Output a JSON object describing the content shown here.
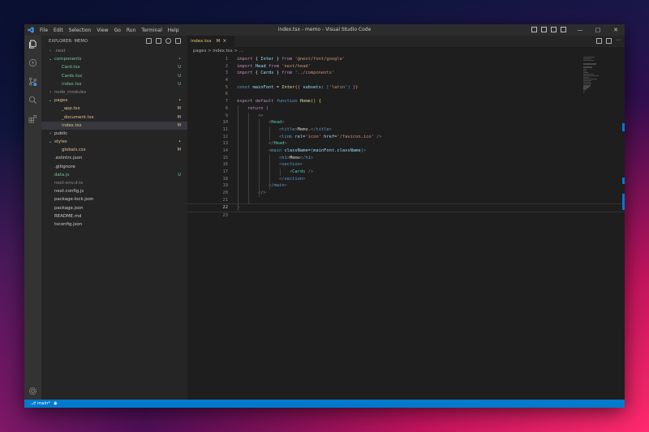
{
  "titlebar": {
    "title": "index.tsx - memo - Visual Studio Code",
    "menu": [
      "File",
      "Edit",
      "Selection",
      "View",
      "Go",
      "Run",
      "Terminal",
      "Help"
    ]
  },
  "sidebar": {
    "header": "EXPLORER: MEMO",
    "items": [
      {
        "name": ".next",
        "type": "folder",
        "open": false,
        "depth": 0,
        "color": "#8c8c8c",
        "badge": ""
      },
      {
        "name": "components",
        "type": "folder",
        "open": true,
        "depth": 0,
        "color": "#73c991",
        "badge": "•"
      },
      {
        "name": "Card.tsx",
        "type": "file",
        "depth": 1,
        "color": "#73c991",
        "badge": "U"
      },
      {
        "name": "Cards.tsx",
        "type": "file",
        "depth": 1,
        "color": "#73c991",
        "badge": "U"
      },
      {
        "name": "index.tsx",
        "type": "file",
        "depth": 1,
        "color": "#73c991",
        "badge": "U"
      },
      {
        "name": "node_modules",
        "type": "folder",
        "open": false,
        "depth": 0,
        "color": "#8c8c8c",
        "badge": ""
      },
      {
        "name": "pages",
        "type": "folder",
        "open": true,
        "depth": 0,
        "color": "#e2c08d",
        "badge": "•"
      },
      {
        "name": "_app.tsx",
        "type": "file",
        "depth": 1,
        "color": "#e2c08d",
        "badge": "M"
      },
      {
        "name": "_document.tsx",
        "type": "file",
        "depth": 1,
        "color": "#e2c08d",
        "badge": "M"
      },
      {
        "name": "index.tsx",
        "type": "file",
        "depth": 1,
        "color": "#e2c08d",
        "badge": "M",
        "selected": true
      },
      {
        "name": "public",
        "type": "folder",
        "open": false,
        "depth": 0,
        "color": "#cccccc",
        "badge": ""
      },
      {
        "name": "styles",
        "type": "folder",
        "open": true,
        "depth": 0,
        "color": "#e2c08d",
        "badge": "•"
      },
      {
        "name": "globals.css",
        "type": "file",
        "depth": 1,
        "color": "#e2c08d",
        "badge": "M"
      },
      {
        "name": ".eslintrc.json",
        "type": "file",
        "depth": 0,
        "color": "#cccccc",
        "badge": ""
      },
      {
        "name": ".gitignore",
        "type": "file",
        "depth": 0,
        "color": "#cccccc",
        "badge": ""
      },
      {
        "name": "data.js",
        "type": "file",
        "depth": 0,
        "color": "#73c991",
        "badge": "U"
      },
      {
        "name": "next-env.d.ts",
        "type": "file",
        "depth": 0,
        "color": "#8c8c8c",
        "badge": ""
      },
      {
        "name": "next.config.js",
        "type": "file",
        "depth": 0,
        "color": "#cccccc",
        "badge": ""
      },
      {
        "name": "package-lock.json",
        "type": "file",
        "depth": 0,
        "color": "#cccccc",
        "badge": ""
      },
      {
        "name": "package.json",
        "type": "file",
        "depth": 0,
        "color": "#cccccc",
        "badge": ""
      },
      {
        "name": "README.md",
        "type": "file",
        "depth": 0,
        "color": "#cccccc",
        "badge": ""
      },
      {
        "name": "tsconfig.json",
        "type": "file",
        "depth": 0,
        "color": "#cccccc",
        "badge": ""
      }
    ]
  },
  "editor": {
    "tab": {
      "label": "index.tsx",
      "status": "M",
      "close": "×"
    },
    "breadcrumb": "pages > index.tsx > ...",
    "current_line": 22,
    "lines": [
      [
        [
          "kw",
          "import "
        ],
        [
          "pl",
          "{ "
        ],
        [
          "var",
          "Inter"
        ],
        [
          "pl",
          " } "
        ],
        [
          "kw",
          "from "
        ],
        [
          "str",
          "'@next/font/google'"
        ]
      ],
      [
        [
          "kw",
          "import "
        ],
        [
          "var",
          "Head "
        ],
        [
          "kw",
          "from "
        ],
        [
          "str",
          "'next/head'"
        ]
      ],
      [
        [
          "kw",
          "import "
        ],
        [
          "pl",
          "{ "
        ],
        [
          "var",
          "Cards"
        ],
        [
          "pl",
          " } "
        ],
        [
          "kw",
          "from "
        ],
        [
          "str",
          "'../components'"
        ]
      ],
      [],
      [
        [
          "kb",
          "const "
        ],
        [
          "var",
          "mainFont"
        ],
        [
          "pl",
          " = "
        ],
        [
          "fn",
          "Inter"
        ],
        [
          "br1",
          "("
        ],
        [
          "br2",
          "{"
        ],
        [
          "pl",
          " "
        ],
        [
          "var",
          "subsets"
        ],
        [
          "pl",
          ": "
        ],
        [
          "br3",
          "["
        ],
        [
          "str",
          "'latin'"
        ],
        [
          "br3",
          "]"
        ],
        [
          "pl",
          " "
        ],
        [
          "br2",
          "}"
        ],
        [
          "br1",
          ")"
        ]
      ],
      [],
      [
        [
          "kw",
          "export "
        ],
        [
          "kw",
          "default "
        ],
        [
          "kb",
          "function "
        ],
        [
          "fn",
          "Home"
        ],
        [
          "br1",
          "()"
        ],
        [
          "pl",
          " "
        ],
        [
          "br1",
          "{"
        ]
      ],
      [
        [
          "pl",
          "    "
        ],
        [
          "kw",
          "return "
        ],
        [
          "br2",
          "("
        ]
      ],
      [
        [
          "pl",
          "        "
        ],
        [
          "tgr",
          "<>"
        ]
      ],
      [
        [
          "pl",
          "            "
        ],
        [
          "tgr",
          "<"
        ],
        [
          "cls",
          "Head"
        ],
        [
          "tgr",
          ">"
        ]
      ],
      [
        [
          "pl",
          "                "
        ],
        [
          "tgr",
          "<"
        ],
        [
          "tag",
          "title"
        ],
        [
          "tgr",
          ">"
        ],
        [
          "pl",
          "Memo."
        ],
        [
          "tgr",
          "</"
        ],
        [
          "tag",
          "title"
        ],
        [
          "tgr",
          ">"
        ]
      ],
      [
        [
          "pl",
          "                "
        ],
        [
          "tgr",
          "<"
        ],
        [
          "tag",
          "link "
        ],
        [
          "attr",
          "rel"
        ],
        [
          "pl",
          "="
        ],
        [
          "str",
          "'icon' "
        ],
        [
          "attr",
          "href"
        ],
        [
          "pl",
          "="
        ],
        [
          "str",
          "'/favicon.ico'"
        ],
        [
          "tgr",
          " />"
        ]
      ],
      [
        [
          "pl",
          "            "
        ],
        [
          "tgr",
          "</"
        ],
        [
          "cls",
          "Head"
        ],
        [
          "tgr",
          ">"
        ]
      ],
      [
        [
          "pl",
          "            "
        ],
        [
          "tgr",
          "<"
        ],
        [
          "tag",
          "main "
        ],
        [
          "attr",
          "className"
        ],
        [
          "pl",
          "="
        ],
        [
          "br3",
          "{"
        ],
        [
          "var",
          "mainFont"
        ],
        [
          "pl",
          "."
        ],
        [
          "var",
          "className"
        ],
        [
          "br3",
          "}"
        ],
        [
          "tgr",
          ">"
        ]
      ],
      [
        [
          "pl",
          "                "
        ],
        [
          "tgr",
          "<"
        ],
        [
          "tag",
          "h1"
        ],
        [
          "tgr",
          ">"
        ],
        [
          "pl",
          "Memo"
        ],
        [
          "tgr",
          "</"
        ],
        [
          "tag",
          "h1"
        ],
        [
          "tgr",
          ">"
        ]
      ],
      [
        [
          "pl",
          "                "
        ],
        [
          "tgr",
          "<"
        ],
        [
          "tag",
          "section"
        ],
        [
          "tgr",
          ">"
        ]
      ],
      [
        [
          "pl",
          "                    "
        ],
        [
          "tgr",
          "<"
        ],
        [
          "cls",
          "Cards"
        ],
        [
          "tgr",
          " />"
        ]
      ],
      [
        [
          "pl",
          "                "
        ],
        [
          "tgr",
          "</"
        ],
        [
          "tag",
          "section"
        ],
        [
          "tgr",
          ">"
        ]
      ],
      [
        [
          "pl",
          "            "
        ],
        [
          "tgr",
          "</"
        ],
        [
          "tag",
          "main"
        ],
        [
          "tgr",
          ">"
        ]
      ],
      [
        [
          "pl",
          "        "
        ],
        [
          "tgr",
          "</>"
        ]
      ],
      [
        [
          "pl",
          "    "
        ],
        [
          "br2",
          ")"
        ]
      ],
      [
        [
          "br1",
          "}"
        ]
      ],
      []
    ]
  },
  "statusbar": {
    "branch": "main*",
    "sync_icon": "sync-icon"
  },
  "colors": {
    "accent": "#007acc",
    "modified": "#e2c08d",
    "untracked": "#73c991"
  }
}
